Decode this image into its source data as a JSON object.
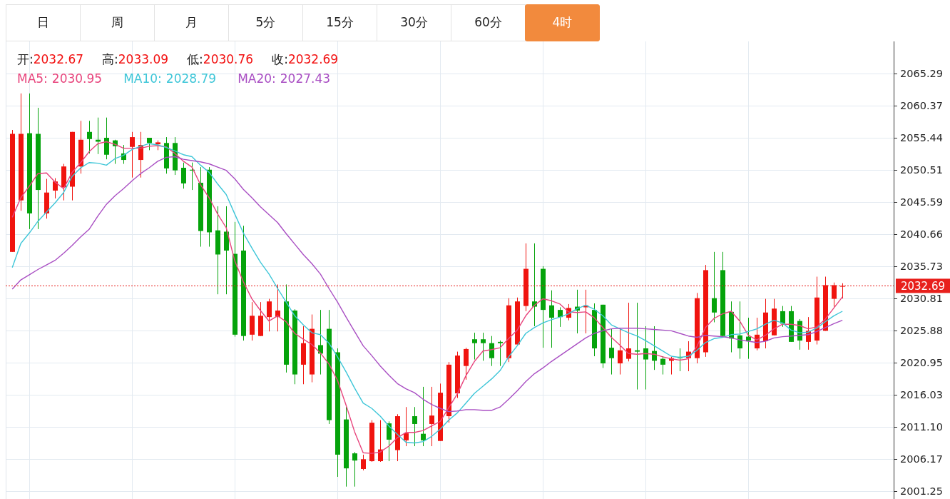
{
  "tabs": [
    {
      "label": "日",
      "selected": false
    },
    {
      "label": "周",
      "selected": false
    },
    {
      "label": "月",
      "selected": false
    },
    {
      "label": "5分",
      "selected": false
    },
    {
      "label": "15分",
      "selected": false
    },
    {
      "label": "30分",
      "selected": false
    },
    {
      "label": "60分",
      "selected": false
    },
    {
      "label": "4时",
      "selected": true
    }
  ],
  "quote": [
    {
      "label": "开:",
      "value": "2032.67"
    },
    {
      "label": "高:",
      "value": "2033.09"
    },
    {
      "label": "低:",
      "value": "2030.76"
    },
    {
      "label": "收:",
      "value": "2032.69"
    }
  ],
  "ma_legend": [
    {
      "value": "2030.95"
    },
    {
      "value": "2028.79"
    },
    {
      "value": "2027.43"
    }
  ],
  "chart": {
    "chart_data": {
      "type": "candlestick",
      "grid": true,
      "ylim": [
        2000,
        2070.18
      ],
      "yticks": [
        {
          "value": 2065.29,
          "label": "2065.29"
        },
        {
          "value": 2060.37,
          "label": "2060.37"
        },
        {
          "value": 2055.44,
          "label": "2055.44"
        },
        {
          "value": 2050.51,
          "label": "2050.51"
        },
        {
          "value": 2045.59,
          "label": "2045.59"
        },
        {
          "value": 2040.66,
          "label": "2040.66"
        },
        {
          "value": 2035.73,
          "label": "2035.73"
        },
        {
          "value": 2030.81,
          "label": "2030.81"
        },
        {
          "value": 2025.88,
          "label": "2025.88"
        },
        {
          "value": 2020.95,
          "label": "2020.95"
        },
        {
          "value": 2016.03,
          "label": "2016.03"
        },
        {
          "value": 2011.1,
          "label": "2011.10"
        },
        {
          "value": 2006.17,
          "label": "2006.17"
        },
        {
          "value": 2001.25,
          "label": "2001.25"
        }
      ],
      "ref_lines": [
        {
          "axis": "y",
          "value": 2032.69,
          "label": "2032.69",
          "color": "#e8201c"
        }
      ],
      "categories": [
        null,
        null,
        null,
        null,
        null,
        null,
        null,
        null,
        null,
        null,
        null,
        null,
        null,
        null,
        null,
        null,
        null,
        null,
        null,
        null,
        null,
        null,
        null,
        null,
        null,
        null,
        null,
        null,
        null,
        null,
        null,
        null,
        null,
        null,
        null,
        null,
        null,
        null,
        null,
        null,
        null,
        null,
        null,
        null,
        null,
        null,
        null,
        null,
        null,
        null,
        null,
        null,
        null,
        null,
        null,
        null,
        null,
        null,
        null,
        null,
        null,
        null,
        null,
        null,
        null,
        null,
        null,
        null,
        null,
        null,
        null,
        null,
        null,
        null,
        null,
        null,
        null,
        null,
        null,
        null,
        null,
        null,
        null,
        null,
        null,
        null,
        null,
        null,
        null,
        null,
        null,
        null,
        null,
        null,
        null,
        null,
        null,
        null
      ],
      "ohlc": [
        [
          2037.9,
          2056.6,
          2037.9,
          2056.0
        ],
        [
          2045.8,
          2062.2,
          2044.2,
          2056.0
        ],
        [
          2056.1,
          2062.2,
          2041.4,
          2043.8
        ],
        [
          2056.0,
          2060.0,
          2041.4,
          2047.4
        ],
        [
          2043.8,
          2049.1,
          2043.0,
          2047.0
        ],
        [
          2047.3,
          2049.2,
          2046.1,
          2048.7
        ],
        [
          2047.8,
          2051.4,
          2045.8,
          2051.0
        ],
        [
          2047.9,
          2056.3,
          2045.8,
          2056.3
        ],
        [
          2051.0,
          2058.0,
          2049.9,
          2055.1
        ],
        [
          2056.3,
          2058.0,
          2053.0,
          2055.2
        ],
        [
          2055.1,
          2058.5,
          2052.9,
          2054.8
        ],
        [
          2055.4,
          2058.5,
          2052.1,
          2052.8
        ],
        [
          2055.0,
          2055.1,
          2051.4,
          2054.1
        ],
        [
          2053.0,
          2054.3,
          2051.4,
          2052.0
        ],
        [
          2054.0,
          2056.3,
          2049.3,
          2055.5
        ],
        [
          2052.0,
          2056.3,
          2049.3,
          2054.3
        ],
        [
          2055.4,
          2055.4,
          2053.5,
          2054.6
        ],
        [
          2054.4,
          2055.0,
          2053.5,
          2054.7
        ],
        [
          2054.6,
          2055.5,
          2049.9,
          2050.7
        ],
        [
          2054.6,
          2055.5,
          2049.7,
          2050.4
        ],
        [
          2050.8,
          2051.6,
          2047.6,
          2048.4
        ],
        [
          2050.5,
          2051.6,
          2047.4,
          2050.4
        ],
        [
          2048.5,
          2050.9,
          2038.7,
          2041.1
        ],
        [
          2050.5,
          2050.9,
          2038.7,
          2040.9
        ],
        [
          2041.2,
          2044.9,
          2031.4,
          2037.5
        ],
        [
          2041.0,
          2044.9,
          2031.4,
          2038.1
        ],
        [
          2037.6,
          2042.5,
          2024.9,
          2025.2
        ],
        [
          2038.1,
          2041.9,
          2024.3,
          2025.0
        ],
        [
          2025.2,
          2030.2,
          2024.3,
          2028.1
        ],
        [
          2025.0,
          2030.2,
          2025.0,
          2028.1
        ],
        [
          2027.9,
          2030.7,
          2025.7,
          2030.3
        ],
        [
          2027.9,
          2032.9,
          2025.7,
          2028.9
        ],
        [
          2030.3,
          2032.9,
          2019.4,
          2020.6
        ],
        [
          2028.9,
          2029.1,
          2017.6,
          2019.1
        ],
        [
          2020.6,
          2026.5,
          2017.6,
          2023.9
        ],
        [
          2019.1,
          2028.3,
          2017.9,
          2026.1
        ],
        [
          2023.6,
          2029.0,
          2019.1,
          2022.3
        ],
        [
          2026.1,
          2029.0,
          2011.5,
          2012.1
        ],
        [
          2022.5,
          2023.1,
          2003.4,
          2006.8
        ],
        [
          2012.2,
          2014.1,
          2001.9,
          2004.7
        ],
        [
          2007.0,
          2007.2,
          2001.9,
          2005.9
        ],
        [
          2004.6,
          2006.8,
          2004.4,
          2006.1
        ],
        [
          2005.8,
          2012.1,
          2005.7,
          2011.7
        ],
        [
          2005.8,
          2012.1,
          2005.7,
          2007.6
        ],
        [
          2011.6,
          2011.9,
          2005.8,
          2009.1
        ],
        [
          2007.5,
          2013.0,
          2005.8,
          2012.7
        ],
        [
          2009.0,
          2014.1,
          2008.1,
          2010.1
        ],
        [
          2012.7,
          2014.1,
          2008.1,
          2011.5
        ],
        [
          2010.0,
          2017.2,
          2008.1,
          2009.0
        ],
        [
          2011.5,
          2017.2,
          2008.1,
          2012.8
        ],
        [
          2008.9,
          2017.7,
          2008.9,
          2016.3
        ],
        [
          2012.7,
          2021.0,
          2011.7,
          2020.6
        ],
        [
          2016.2,
          2022.6,
          2015.5,
          2022.0
        ],
        [
          2020.4,
          2023.2,
          2018.3,
          2023.0
        ],
        [
          2024.5,
          2025.5,
          2021.4,
          2023.9
        ],
        [
          2024.5,
          2025.5,
          2021.2,
          2023.9
        ],
        [
          2023.9,
          2025.0,
          2020.4,
          2021.6
        ],
        [
          2024.1,
          2024.3,
          2020.4,
          2023.9
        ],
        [
          2021.6,
          2030.8,
          2021.0,
          2029.7
        ],
        [
          2023.7,
          2030.9,
          2023.7,
          2030.3
        ],
        [
          2029.6,
          2039.2,
          2028.8,
          2035.3
        ],
        [
          2030.3,
          2039.2,
          2026.5,
          2029.5
        ],
        [
          2035.3,
          2035.7,
          2023.2,
          2029.0
        ],
        [
          2029.7,
          2032.0,
          2023.2,
          2027.8
        ],
        [
          2029.0,
          2029.4,
          2026.4,
          2027.9
        ],
        [
          2027.8,
          2029.9,
          2027.4,
          2029.3
        ],
        [
          2029.5,
          2032.1,
          2025.4,
          2028.9
        ],
        [
          2029.4,
          2032.1,
          2025.4,
          2029.7
        ],
        [
          2029.0,
          2030.0,
          2021.9,
          2023.1
        ],
        [
          2029.8,
          2029.8,
          2020.1,
          2020.8
        ],
        [
          2023.2,
          2026.1,
          2019.1,
          2021.6
        ],
        [
          2020.8,
          2026.1,
          2019.1,
          2022.8
        ],
        [
          2021.5,
          2030.1,
          2021.1,
          2023.1
        ],
        [
          2022.8,
          2030.1,
          2016.8,
          2022.6
        ],
        [
          2023.1,
          2026.5,
          2016.8,
          2021.4
        ],
        [
          2022.7,
          2026.5,
          2019.8,
          2021.2
        ],
        [
          2021.5,
          2021.9,
          2019.1,
          2020.6
        ],
        [
          2021.2,
          2021.8,
          2019.1,
          2021.6
        ],
        [
          2021.8,
          2023.1,
          2019.6,
          2021.6
        ],
        [
          2021.6,
          2024.2,
          2019.6,
          2022.6
        ],
        [
          2021.6,
          2031.6,
          2020.8,
          2030.8
        ],
        [
          2022.5,
          2035.9,
          2021.8,
          2035.1
        ],
        [
          2030.8,
          2037.9,
          2027.1,
          2028.6
        ],
        [
          2035.1,
          2037.9,
          2024.8,
          2025.0
        ],
        [
          2028.7,
          2030.3,
          2022.5,
          2024.6
        ],
        [
          2025.1,
          2030.3,
          2021.5,
          2023.1
        ],
        [
          2024.9,
          2027.8,
          2021.5,
          2024.3
        ],
        [
          2023.1,
          2027.8,
          2022.8,
          2025.2
        ],
        [
          2024.2,
          2030.7,
          2023.1,
          2028.6
        ],
        [
          2025.1,
          2030.7,
          2025.1,
          2029.2
        ],
        [
          2028.8,
          2029.6,
          2026.4,
          2026.9
        ],
        [
          2028.8,
          2029.6,
          2024.1,
          2024.1
        ],
        [
          2027.3,
          2027.6,
          2022.9,
          2024.3
        ],
        [
          2024.1,
          2027.9,
          2022.9,
          2025.8
        ],
        [
          2024.3,
          2034.1,
          2023.7,
          2030.9
        ],
        [
          2025.8,
          2034.1,
          2025.8,
          2032.8
        ],
        [
          2030.7,
          2033.2,
          2029.5,
          2032.8
        ],
        [
          2032.67,
          2033.09,
          2030.76,
          2032.69
        ]
      ],
      "series": [
        {
          "name": "MA5:",
          "type": "line",
          "color": "#e8457d",
          "values": [
            2043.2,
            2046.2,
            2048.0,
            2049.9,
            2050.0,
            2048.6,
            2047.6,
            2050.1,
            2051.6,
            2053.3,
            2054.5,
            2054.8,
            2054.4,
            2053.8,
            2053.8,
            2053.8,
            2054.1,
            2054.2,
            2054.0,
            2053.0,
            2051.8,
            2050.9,
            2048.2,
            2046.2,
            2043.7,
            2041.6,
            2036.5,
            2033.3,
            2030.7,
            2028.9,
            2027.3,
            2028.1,
            2027.2,
            2025.4,
            2024.5,
            2023.7,
            2022.4,
            2020.7,
            2018.2,
            2014.4,
            2010.3,
            2007.1,
            2007.0,
            2007.2,
            2008.1,
            2009.4,
            2010.2,
            2010.2,
            2010.5,
            2011.2,
            2011.9,
            2014.0,
            2016.1,
            2018.9,
            2021.1,
            2022.7,
            2022.9,
            2023.2,
            2024.6,
            2025.9,
            2028.1,
            2029.7,
            2030.7,
            2030.4,
            2029.9,
            2028.7,
            2028.6,
            2028.7,
            2027.8,
            2026.3,
            2024.8,
            2023.6,
            2022.3,
            2022.2,
            2022.3,
            2022.2,
            2021.8,
            2021.5,
            2021.3,
            2021.5,
            2023.4,
            2026.3,
            2027.7,
            2028.4,
            2028.8,
            2027.3,
            2025.1,
            2024.4,
            2025.1,
            2026.1,
            2026.8,
            2026.8,
            2026.6,
            2026.1,
            2026.4,
            2027.6,
            2029.3,
            2031.0
          ]
        },
        {
          "name": "MA10:",
          "type": "line",
          "color": "#3ec6d8",
          "values": [
            2035.5,
            2039.2,
            2040.8,
            2042.6,
            2044.0,
            2045.4,
            2047.0,
            2049.5,
            2050.8,
            2051.6,
            2051.5,
            2051.2,
            2052.2,
            2052.7,
            2053.6,
            2054.1,
            2054.5,
            2054.3,
            2053.9,
            2053.4,
            2052.8,
            2052.5,
            2051.2,
            2050.1,
            2048.3,
            2046.7,
            2043.7,
            2040.8,
            2038.5,
            2036.3,
            2034.5,
            2032.3,
            2030.2,
            2028.1,
            2026.7,
            2025.5,
            2025.2,
            2023.9,
            2021.8,
            2019.5,
            2017.0,
            2014.7,
            2013.9,
            2012.7,
            2011.2,
            2009.9,
            2008.7,
            2008.6,
            2008.8,
            2009.6,
            2010.7,
            2012.1,
            2013.2,
            2014.7,
            2016.2,
            2017.3,
            2018.4,
            2019.7,
            2021.8,
            2023.5,
            2025.4,
            2026.3,
            2027.0,
            2027.5,
            2027.9,
            2028.4,
            2029.2,
            2029.7,
            2029.1,
            2028.1,
            2026.7,
            2026.1,
            2025.5,
            2025.0,
            2024.3,
            2023.5,
            2022.7,
            2021.9,
            2021.7,
            2021.9,
            2022.8,
            2024.0,
            2024.6,
            2024.8,
            2025.2,
            2025.3,
            2025.7,
            2026.1,
            2026.8,
            2027.4,
            2027.0,
            2025.9,
            2025.5,
            2025.6,
            2026.2,
            2027.2,
            2028.1,
            2028.8
          ]
        },
        {
          "name": "MA20:",
          "type": "line",
          "color": "#a94fc3",
          "values": [
            2032.2,
            2033.6,
            2034.4,
            2035.2,
            2035.9,
            2036.6,
            2037.7,
            2038.9,
            2040.2,
            2041.4,
            2043.4,
            2045.2,
            2046.5,
            2047.6,
            2048.8,
            2049.9,
            2050.8,
            2051.8,
            2052.4,
            2052.5,
            2052.1,
            2051.9,
            2051.7,
            2051.4,
            2050.9,
            2050.4,
            2049.1,
            2047.5,
            2046.2,
            2044.8,
            2043.6,
            2042.4,
            2040.7,
            2039.1,
            2037.5,
            2036.1,
            2034.5,
            2032.3,
            2030.2,
            2027.9,
            2025.7,
            2023.5,
            2022.0,
            2020.4,
            2019.0,
            2017.7,
            2016.9,
            2016.3,
            2015.3,
            2014.5,
            2013.9,
            2013.4,
            2013.5,
            2013.7,
            2013.7,
            2013.6,
            2013.6,
            2014.1,
            2015.3,
            2016.6,
            2018.0,
            2019.2,
            2020.1,
            2021.1,
            2022.0,
            2022.9,
            2023.8,
            2024.7,
            2025.4,
            2025.8,
            2026.1,
            2026.2,
            2026.2,
            2026.2,
            2026.1,
            2026.0,
            2025.9,
            2025.8,
            2025.4,
            2025.0,
            2024.8,
            2025.1,
            2025.0,
            2024.9,
            2024.7,
            2024.4,
            2024.2,
            2024.0,
            2024.2,
            2024.7,
            2024.9,
            2025.0,
            2025.1,
            2025.2,
            2025.7,
            2026.3,
            2026.9,
            2027.4
          ]
        }
      ]
    }
  }
}
